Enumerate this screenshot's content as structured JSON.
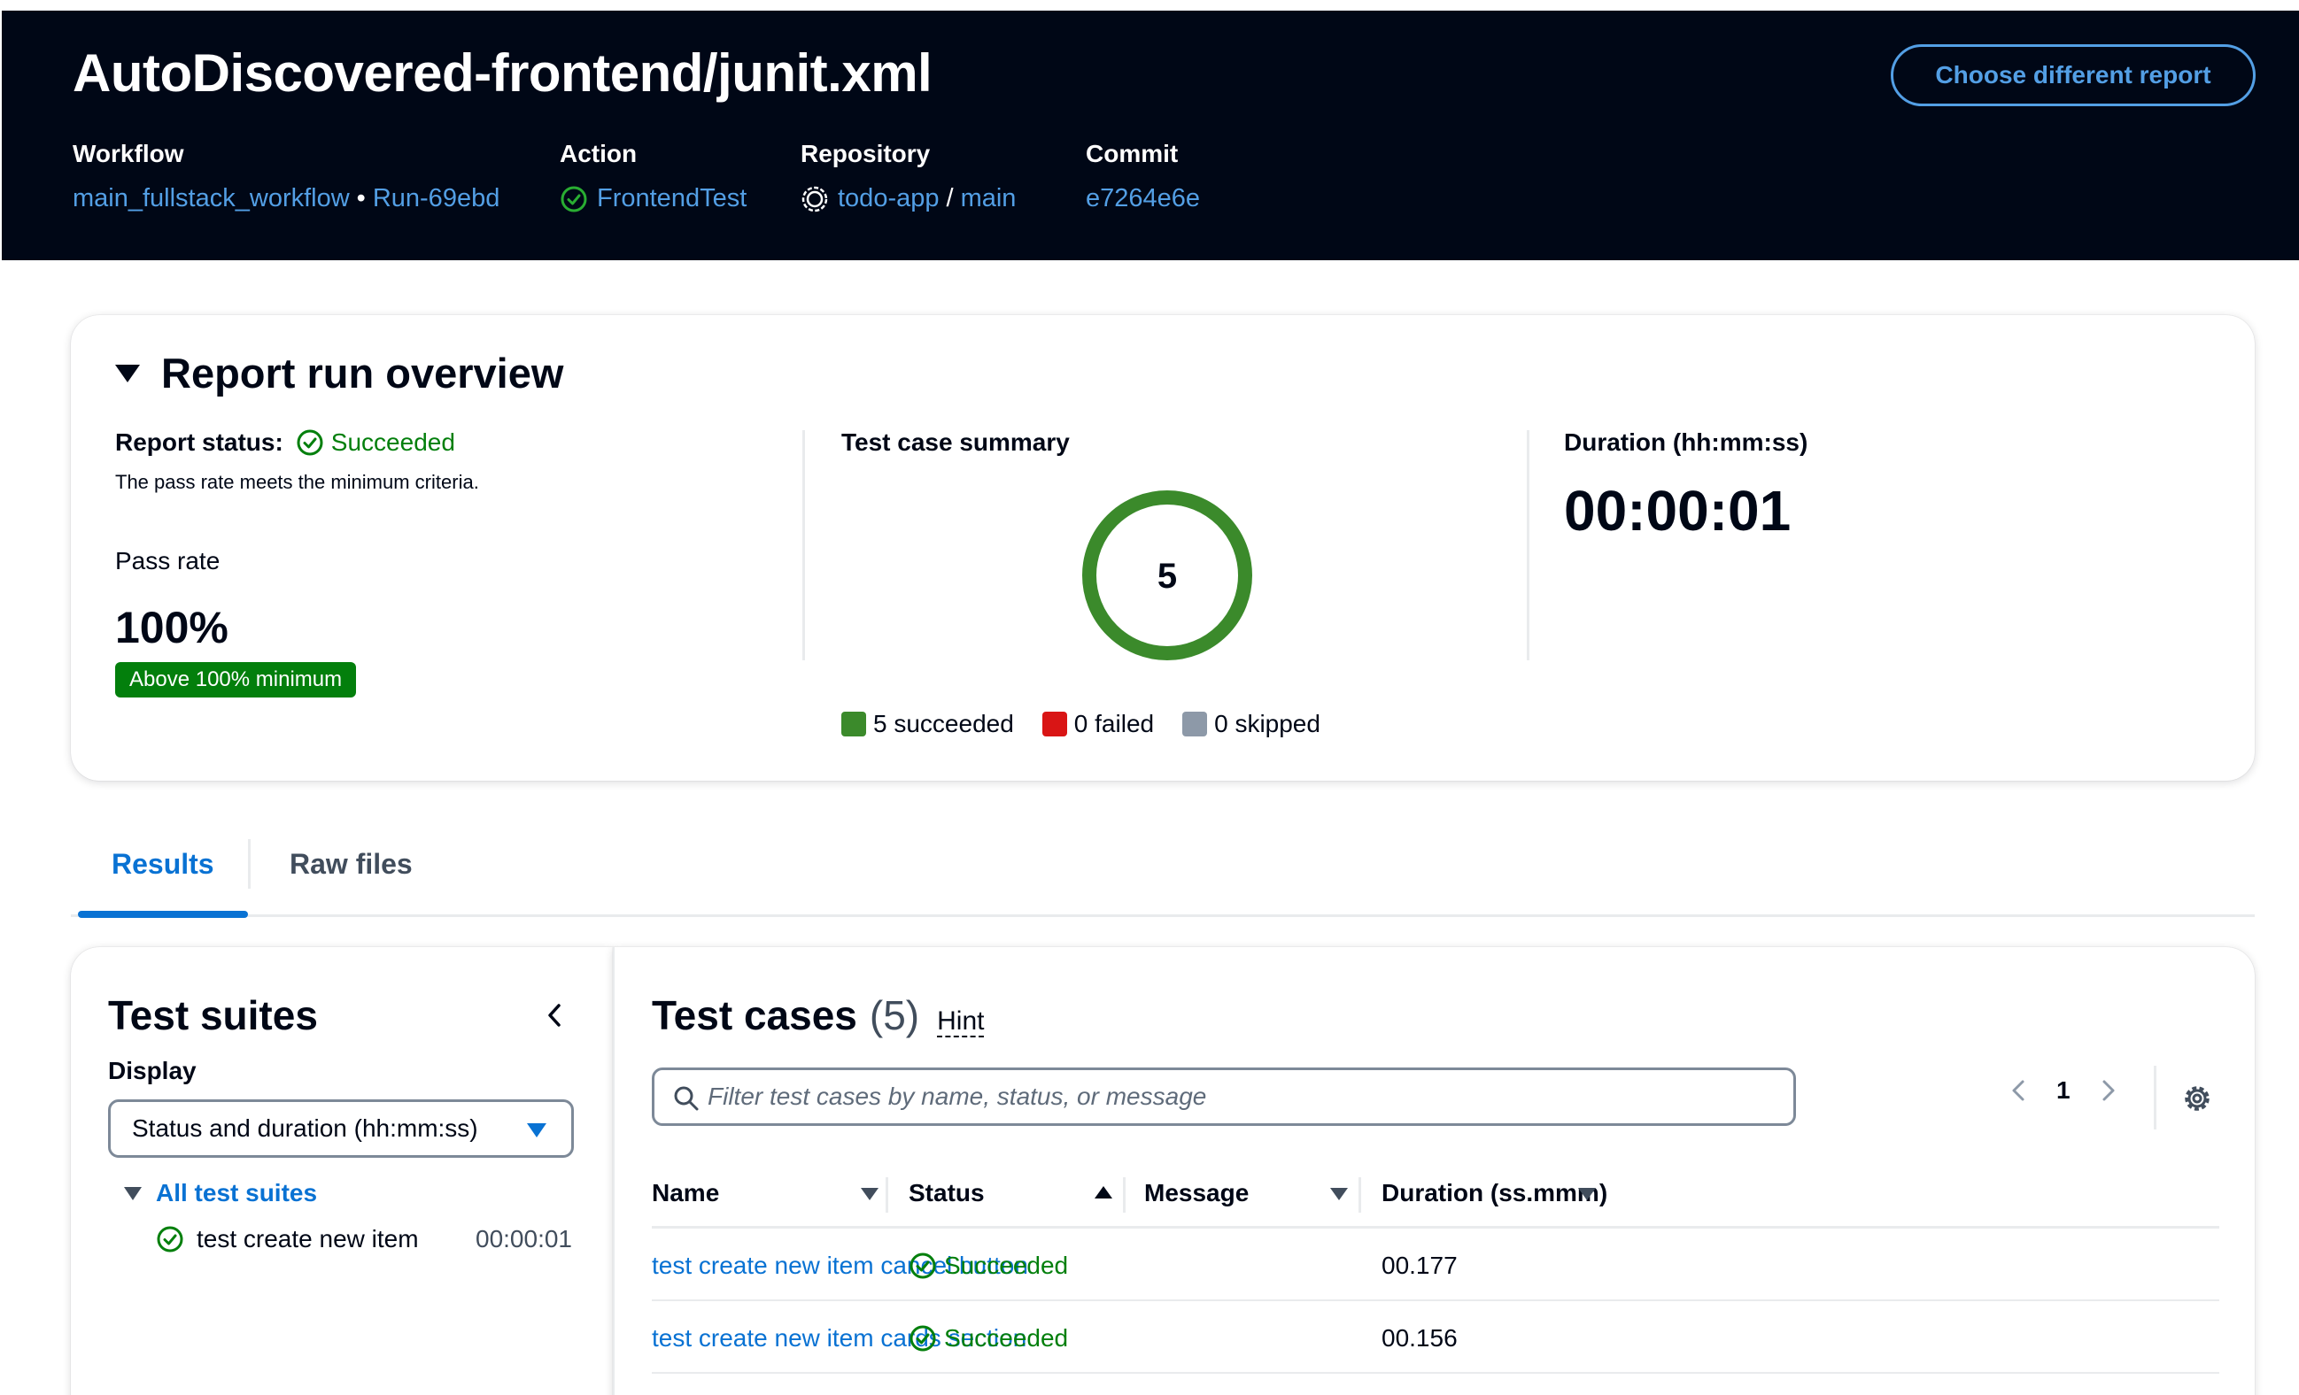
{
  "header": {
    "title": "AutoDiscovered-frontend/junit.xml",
    "choose_button": "Choose different report",
    "workflow": {
      "label": "Workflow",
      "name": "main_fullstack_workflow",
      "separator": "•",
      "run": "Run-69ebd"
    },
    "action": {
      "label": "Action",
      "name": "FrontendTest",
      "icon": "check-circle-icon"
    },
    "repository": {
      "label": "Repository",
      "name": "todo-app",
      "separator": "/",
      "branch": "main",
      "icon": "repository-icon"
    },
    "commit": {
      "label": "Commit",
      "value": "e7264e6e"
    }
  },
  "overview": {
    "title": "Report run overview",
    "report_status_label": "Report status:",
    "report_status_value": "Succeeded",
    "criteria_text": "The pass rate meets the minimum criteria.",
    "pass_rate_label": "Pass rate",
    "pass_rate_value": "100%",
    "pass_rate_badge": "Above 100% minimum",
    "summary_label": "Test case summary",
    "summary_total": "5",
    "legend": {
      "succeeded": "5 succeeded",
      "failed": "0 failed",
      "skipped": "0 skipped"
    },
    "duration_label": "Duration (hh:mm:ss)",
    "duration_value": "00:00:01"
  },
  "chart_data": {
    "type": "pie",
    "categories": [
      "succeeded",
      "failed",
      "skipped"
    ],
    "values": [
      5,
      0,
      0
    ],
    "colors": [
      "#037f0c",
      "#d91515",
      "#8d99a8"
    ]
  },
  "tabs": [
    {
      "label": "Results",
      "active": true
    },
    {
      "label": "Raw files",
      "active": false
    }
  ],
  "suites": {
    "title": "Test suites",
    "display_label": "Display",
    "display_value": "Status and duration (hh:mm:ss)",
    "root_label": "All test suites",
    "items": [
      {
        "name": "test create new item",
        "time": "00:00:01"
      }
    ]
  },
  "cases": {
    "title": "Test cases",
    "count": "(5)",
    "hint": "Hint",
    "search_placeholder": "Filter test cases by name, status, or message",
    "page": "1",
    "columns": {
      "name": "Name",
      "status": "Status",
      "message": "Message",
      "duration": "Duration (ss.mmm)"
    },
    "rows": [
      {
        "name": "test create new item cancel button",
        "status": "Succeeded",
        "message": "",
        "duration": "00.177"
      },
      {
        "name": "test create new item cards section",
        "status": "Succeeded",
        "message": "",
        "duration": "00.156"
      }
    ]
  },
  "colors": {
    "header_bg": "#000716",
    "link": "#539fe5",
    "accent": "#0972d3",
    "success": "#037f0c",
    "error": "#d91515",
    "neutral": "#8d99a8"
  }
}
